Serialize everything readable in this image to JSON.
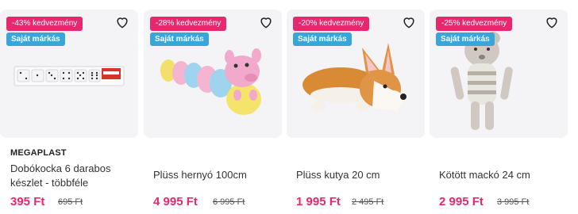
{
  "products": [
    {
      "discount": "-43% kedvezmény",
      "brand_badge": "Saját márkás",
      "brand": "MEGAPLAST",
      "name": "Dobókocka 6 darabos készlet - többféle",
      "price": "395 Ft",
      "old_price": "695 Ft",
      "image_icon": "dice-set-icon"
    },
    {
      "discount": "-28% kedvezmény",
      "brand_badge": "Saját márkás",
      "brand": "",
      "name": "Plüss hernyó 100cm",
      "price": "4 995 Ft",
      "old_price": "6 995 Ft",
      "image_icon": "plush-caterpillar-icon"
    },
    {
      "discount": "-20% kedvezmény",
      "brand_badge": "Saját márkás",
      "brand": "",
      "name": "Plüss kutya 20 cm",
      "price": "1 995 Ft",
      "old_price": "2 495 Ft",
      "image_icon": "plush-dog-icon"
    },
    {
      "discount": "-25% kedvezmény",
      "brand_badge": "Saját márkás",
      "brand": "",
      "name": "Kötött mackó 24 cm",
      "price": "2 995 Ft",
      "old_price": "3 995 Ft",
      "image_icon": "knitted-bear-icon"
    }
  ],
  "colors": {
    "discount_badge": "#e6286e",
    "brand_badge": "#3aa5d8",
    "price": "#e6286e",
    "image_background": "#f4f4f6"
  },
  "icons": {
    "favorite": "heart-outline-icon"
  }
}
